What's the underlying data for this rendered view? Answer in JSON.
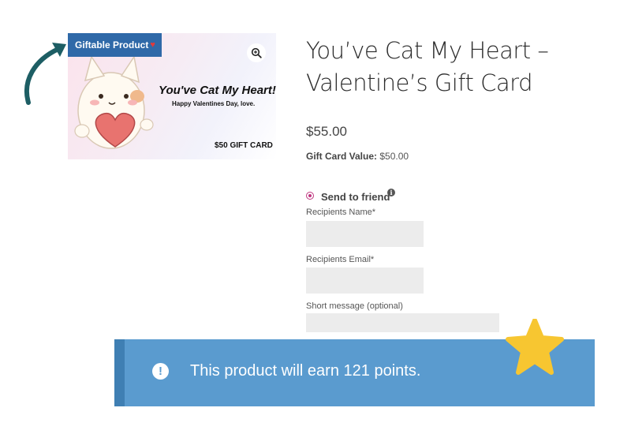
{
  "product_image": {
    "badge_label": "Giftable Product",
    "badge_icon": "heart-icon",
    "zoom_icon": "zoom-in-icon",
    "card_title": "You've Cat My Heart!",
    "card_subtitle": "Happy Valentines Day, love.",
    "card_amount": "$50 GIFT CARD"
  },
  "product": {
    "title": "You’ve Cat My Heart – Valentine’s Gift Card",
    "price": "$55.00",
    "gift_card_value_label": "Gift Card Value:",
    "gift_card_value": "$50.00"
  },
  "send_option": {
    "label": "Send to friend",
    "selected": true,
    "info_icon": "info-icon"
  },
  "form": {
    "recipient_name_label": "Recipients Name*",
    "recipient_name_value": "",
    "recipient_email_label": "Recipients Email*",
    "recipient_email_value": "",
    "message_label": "Short message (optional)",
    "message_value": ""
  },
  "notice": {
    "icon": "exclamation-icon",
    "text": "This product will earn 121 points."
  },
  "colors": {
    "badge": "#2f69a8",
    "notice_bg": "#5a9bcf",
    "notice_border": "#3f7fb3",
    "arrow": "#1d5e64",
    "star": "#f7c631",
    "radio": "#c0357f"
  }
}
